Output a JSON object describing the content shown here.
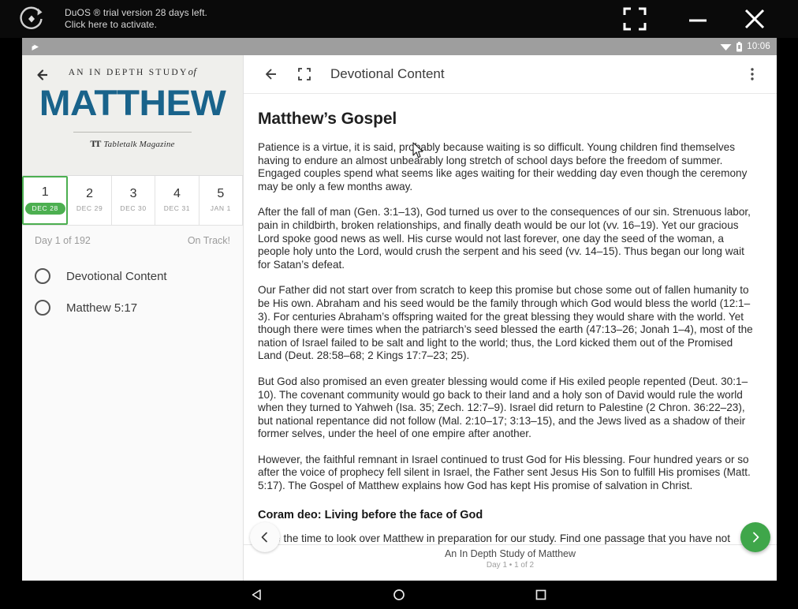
{
  "emulator": {
    "logo_icon": "duos-circular-arrow-logo",
    "trial_line1": "DuOS ® trial version 28 days left.",
    "trial_line2": "Click here to activate.",
    "maximize_icon": "maximize-icon",
    "minimize_icon": "minimize-icon",
    "close_icon": "close-icon"
  },
  "statusbar": {
    "media_icon": "play-media-icon",
    "wifi_icon": "wifi-icon",
    "battery_icon": "battery-icon",
    "clock": "10:06"
  },
  "left_pane": {
    "back_icon": "back-arrow-icon",
    "cover": {
      "kicker_pre": "AN IN DEPTH STUDY",
      "kicker_of": "of",
      "title": "MATTHEW",
      "publisher_mark": "TT",
      "publisher": "Tabletalk Magazine",
      "title_color": "#19638b"
    },
    "day_tabs": [
      {
        "num": "1",
        "date": "DEC 28",
        "active": true
      },
      {
        "num": "2",
        "date": "DEC 29",
        "active": false
      },
      {
        "num": "3",
        "date": "DEC 30",
        "active": false
      },
      {
        "num": "4",
        "date": "DEC 31",
        "active": false
      },
      {
        "num": "5",
        "date": "JAN 1",
        "active": false
      }
    ],
    "active_accent": "#4caf50",
    "progress_left": "Day 1 of 192",
    "progress_right": "On Track!",
    "tasks": [
      {
        "label": "Devotional Content",
        "checked": false
      },
      {
        "label": "Matthew 5:17",
        "checked": false
      }
    ]
  },
  "toolbar": {
    "back_icon": "back-arrow-icon",
    "fullscreen_icon": "fullscreen-expand-icon",
    "title": "Devotional Content",
    "overflow_icon": "overflow-menu-icon"
  },
  "content": {
    "heading": "Matthew’s Gospel",
    "paragraphs": [
      "Patience is a virtue, it is said, probably because waiting is so difficult. Young children find themselves having to endure an almost unbearably long stretch of school days before the freedom of summer. Engaged couples spend what seems like ages waiting for their wedding day even though the ceremony may be only a few months away.",
      "After the fall of man (Gen. 3:1–13), God turned us over to the consequences of our sin. Strenuous labor, pain in childbirth, broken relationships, and finally death would be our lot (vv. 16–19). Yet our gracious Lord spoke good news as well. His curse would not last forever, one day the seed of the woman, a people holy unto the Lord, would crush the serpent and his seed (vv. 14–15). Thus began our long wait for Satan’s defeat.",
      "Our Father did not start over from scratch to keep this promise but chose some out of fallen humanity to be His own. Abraham and his seed would be the family through which God would bless the world (12:1–3). For centuries Abraham’s offspring waited for the great blessing they would share with the world. Yet though there were times when the patriarch’s seed blessed the earth (47:13–26; Jonah 1–4), most of the nation of Israel failed to be salt and light to the world; thus, the Lord kicked them out of the Promised Land (Deut. 28:58–68; 2 Kings 17:7–23; 25).",
      "But God also promised an even greater blessing would come if His exiled people repented (Deut. 30:1–10). The covenant community would go back to their land and a holy son of David would rule the world when they turned to Yahweh (Isa. 35; Zech. 12:7–9). Israel did return to Palestine (2 Chron. 36:22–23), but national repentance did not follow (Mal. 2:10–17; 3:13–15), and the Jews lived as a shadow of their former selves, under the heel of one empire after another.",
      "However, the faithful remnant in Israel continued to trust God for His blessing. Four hundred years or so after the voice of prophecy fell silent in Israel, the Father sent Jesus His Son to fulfill His promises (Matt. 5:17). The Gospel of Matthew explains how God has kept His promise of salvation in Christ."
    ],
    "subheading": "Coram deo: Living before the face of God",
    "truncated_paragraph": "Take the time to look over Matthew in preparation for our study. Find one passage that you have not spent much time examining. Meditate on that text today and ask the Lord to help you focus on His Word.",
    "cursor_icon": "mouse-cursor"
  },
  "content_footer": {
    "title": "An In Depth Study of Matthew",
    "subtitle": "Day 1 • 1 of 2",
    "prev_icon": "chevron-left-icon",
    "next_icon": "chevron-right-icon",
    "next_color": "#3fa64a"
  },
  "navbar": {
    "back_icon": "android-back-triangle-icon",
    "home_icon": "android-home-circle-icon",
    "recents_icon": "android-recents-square-icon"
  }
}
